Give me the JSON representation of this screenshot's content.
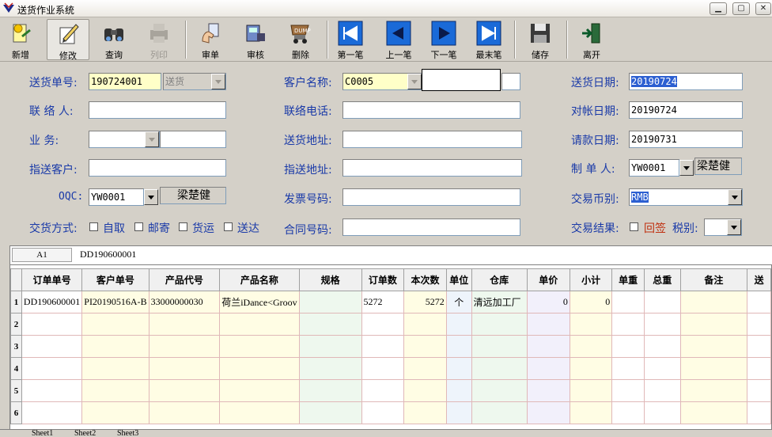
{
  "window": {
    "title": "送货作业系统"
  },
  "toolbar": {
    "new": "新增",
    "edit": "修改",
    "query": "查询",
    "print": "列印",
    "review": "审单",
    "audit": "审核",
    "delete": "删除",
    "first": "第一笔",
    "prev": "上一笔",
    "next": "下一笔",
    "last": "最末笔",
    "save": "储存",
    "exit": "离开"
  },
  "form": {
    "delivery_no_label": "送货单号:",
    "delivery_no": "190724001",
    "delivery_type": "送货",
    "customer_label": "客户名称:",
    "customer_code": "C0005",
    "delivery_date_label": "送货日期:",
    "delivery_date": "20190724",
    "contact_label": "联 络 人:",
    "phone_label": "联络电话:",
    "reconcile_date_label": "对帐日期:",
    "reconcile_date": "20190724",
    "business_label": "业    务:",
    "address_label": "送货地址:",
    "payment_date_label": "请款日期:",
    "payment_date": "20190731",
    "assigned_customer_label": "指送客户:",
    "assigned_address_label": "指送地址:",
    "creator_label": "制 单 人:",
    "creator_code": "YW0001",
    "creator_name": "梁楚健",
    "oqc_label": "OQC:",
    "oqc_code": "YW0001",
    "oqc_name": "梁楚健",
    "invoice_label": "发票号码:",
    "currency_label": "交易币别:",
    "currency": "RMB",
    "delivery_method_label": "交货方式:",
    "methods": [
      "自取",
      "邮寄",
      "货运",
      "送达"
    ],
    "contract_label": "合同号码:",
    "result_label": "交易结果:",
    "result_option": "回签",
    "tax_label": "税别:"
  },
  "sheet": {
    "cell_ref": "A1",
    "formula_value": "DD190600001",
    "headers": [
      "订单单号",
      "客户单号",
      "产品代号",
      "产品名称",
      "规格",
      "订单数",
      "本次数",
      "单位",
      "仓库",
      "单价",
      "小计",
      "单重",
      "总重",
      "备注",
      "送"
    ],
    "row_numbers": [
      "1",
      "2",
      "3",
      "4",
      "5",
      "6"
    ],
    "row1": {
      "order_no": "DD190600001",
      "customer_no": "PI20190516A-B",
      "product_code": "33000000030",
      "product_name": "荷兰iDance<Groov",
      "order_qty": "5272",
      "this_qty": "5272",
      "unit": "个",
      "warehouse": "清远加工厂",
      "unit_price": "0",
      "subtotal": "0"
    },
    "tabs": [
      "Sheet1",
      "Sheet2",
      "Sheet3"
    ]
  }
}
